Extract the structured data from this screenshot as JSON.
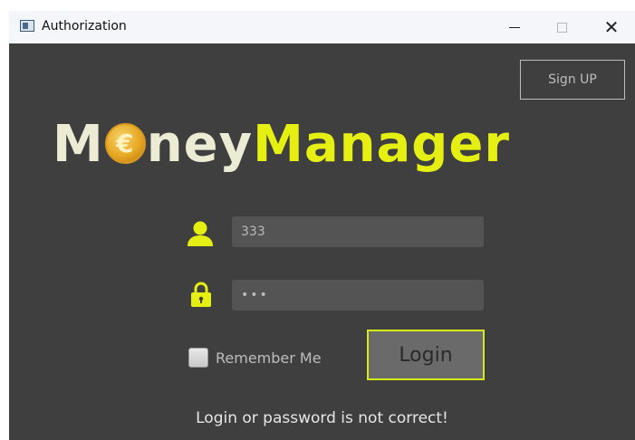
{
  "window": {
    "title": "Authorization",
    "close_glyph": "✕"
  },
  "header": {
    "signup_label": "Sign UP"
  },
  "logo": {
    "part1_a": "M",
    "part1_b": "ney",
    "part2": "Manager",
    "coin_icon": "euro-coin-icon"
  },
  "form": {
    "username_value": "333",
    "password_mask": "•••",
    "remember_label": "Remember Me",
    "remember_checked": false,
    "login_label": "Login"
  },
  "status": {
    "message": "Login or password is not correct!"
  },
  "colors": {
    "background": "#3f3f3f",
    "accent": "#e5f012",
    "logo_light": "#ecebd4",
    "field_bg": "#545454"
  }
}
